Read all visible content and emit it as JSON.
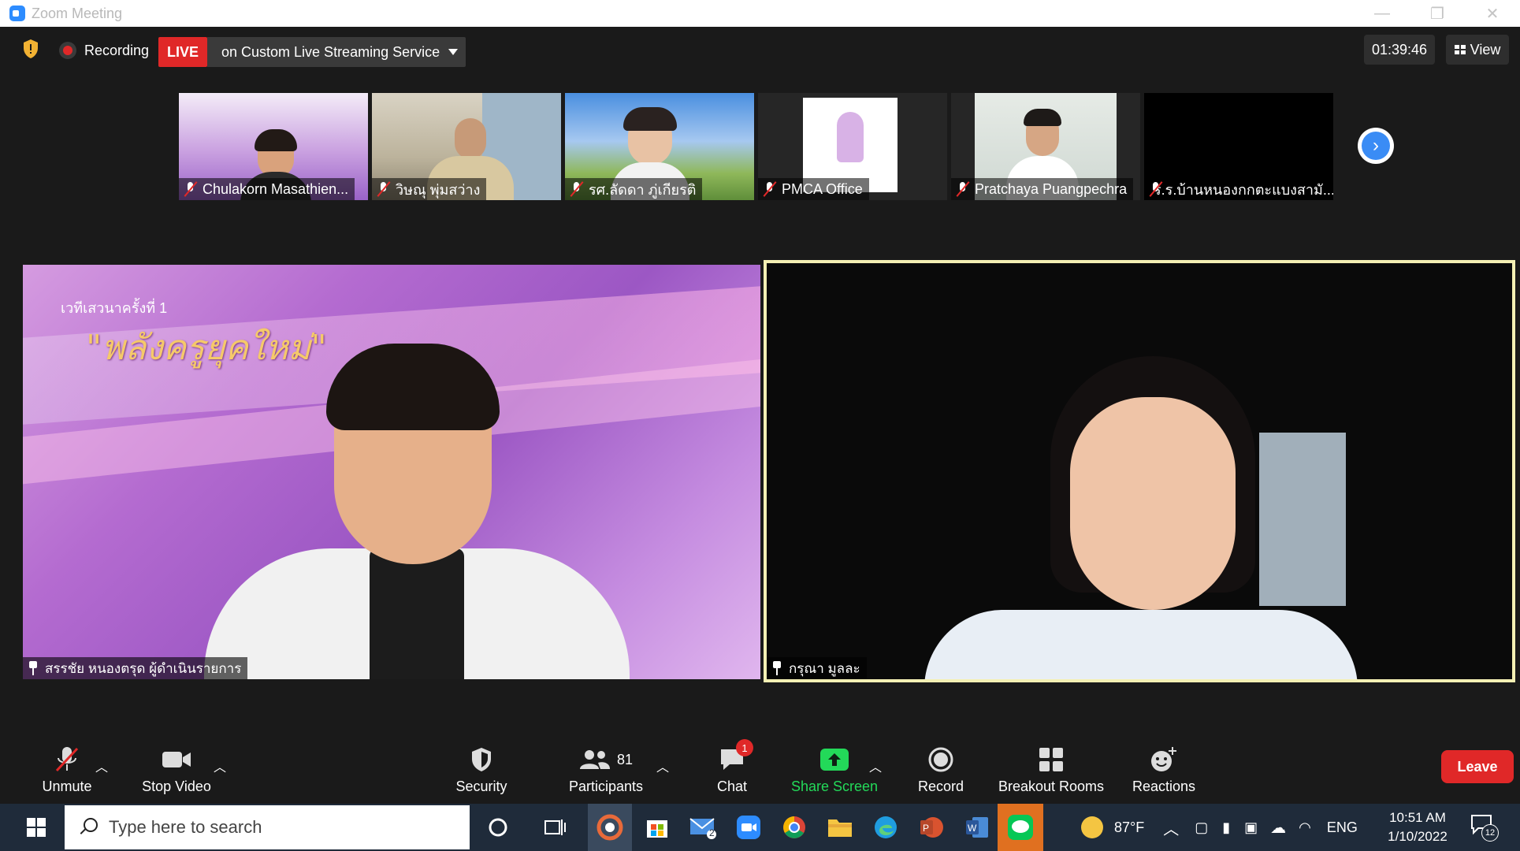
{
  "window": {
    "title": "Zoom Meeting",
    "minimize": "—",
    "restore": "❐",
    "close": "✕"
  },
  "topbar": {
    "recording_label": "Recording",
    "live_label": "LIVE",
    "stream_label": "on Custom Live Streaming Service",
    "timer": "01:39:46",
    "view_label": "View"
  },
  "thumbnails": [
    {
      "name": "Chulakorn Masathien..."
    },
    {
      "name": "วิษณุ พุ่มสว่าง"
    },
    {
      "name": "รศ.ลัดดา ภู่เกียรติ"
    },
    {
      "name": "PMCA Office"
    },
    {
      "name": "Pratchaya Puangpechra"
    },
    {
      "name": "ร.ร.บ้านหนองกกตะแบงสามั..."
    }
  ],
  "videos": {
    "left": {
      "name": "สรรชัย หนองตรุด ผู้ดำเนินรายการ",
      "headline": "\"พลังครูยุคใหม่\"",
      "sub": "เวทีเสวนาครั้งที่ 1"
    },
    "right": {
      "name": "กรุณา มูลละ"
    }
  },
  "toolbar": {
    "unmute": "Unmute",
    "stop_video": "Stop Video",
    "security": "Security",
    "participants": "Participants",
    "participants_count": "81",
    "chat": "Chat",
    "chat_badge": "1",
    "share_screen": "Share Screen",
    "record": "Record",
    "breakout_rooms": "Breakout Rooms",
    "reactions": "Reactions",
    "leave": "Leave"
  },
  "taskbar": {
    "search_placeholder": "Type here to search",
    "mail_badge": "2",
    "temperature": "87°F",
    "language": "ENG",
    "time": "10:51 AM",
    "date": "1/10/2022",
    "notification_count": "12"
  },
  "colors": {
    "accent_blue": "#2d8cff",
    "live_red": "#e02828",
    "share_green": "#23d959",
    "active_speaker_border": "#f4f0b4"
  }
}
